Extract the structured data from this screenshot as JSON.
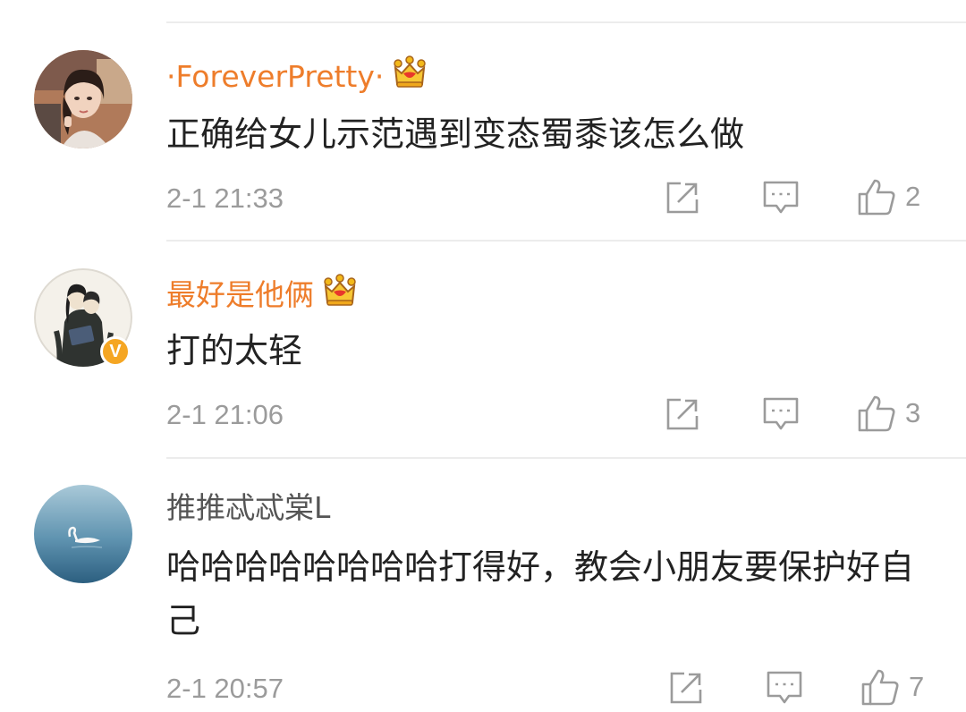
{
  "comments": [
    {
      "username": "·ForeverPretty·",
      "user_style": "vip",
      "text": "正确给女儿示范遇到变态蜀黍该怎么做",
      "time": "2-1 21:33",
      "likes": "2",
      "avatar_icon": "woman-portrait-avatar",
      "verified": false
    },
    {
      "username": "最好是他俩",
      "user_style": "vip",
      "text": "打的太轻",
      "time": "2-1 21:06",
      "likes": "3",
      "avatar_icon": "illustrated-couple-avatar",
      "verified": true
    },
    {
      "username": "推推忒忒棠L",
      "user_style": "normal",
      "text": "哈哈哈哈哈哈哈哈打得好，教会小朋友要保护好自己",
      "time": "2-1 20:57",
      "likes": "7",
      "avatar_icon": "swan-on-water-avatar",
      "verified": false
    }
  ],
  "colors": {
    "vip_name": "#ee7d2b",
    "normal_name": "#555555",
    "body_text": "#222222",
    "meta_text": "#9b9b9b",
    "verified_badge": "#f5a623"
  },
  "icons": {
    "vip_badge": "crown-icon",
    "verified_badge": "verified-v-icon",
    "share": "share-icon",
    "comment": "comment-icon",
    "like": "thumbs-up-icon"
  }
}
